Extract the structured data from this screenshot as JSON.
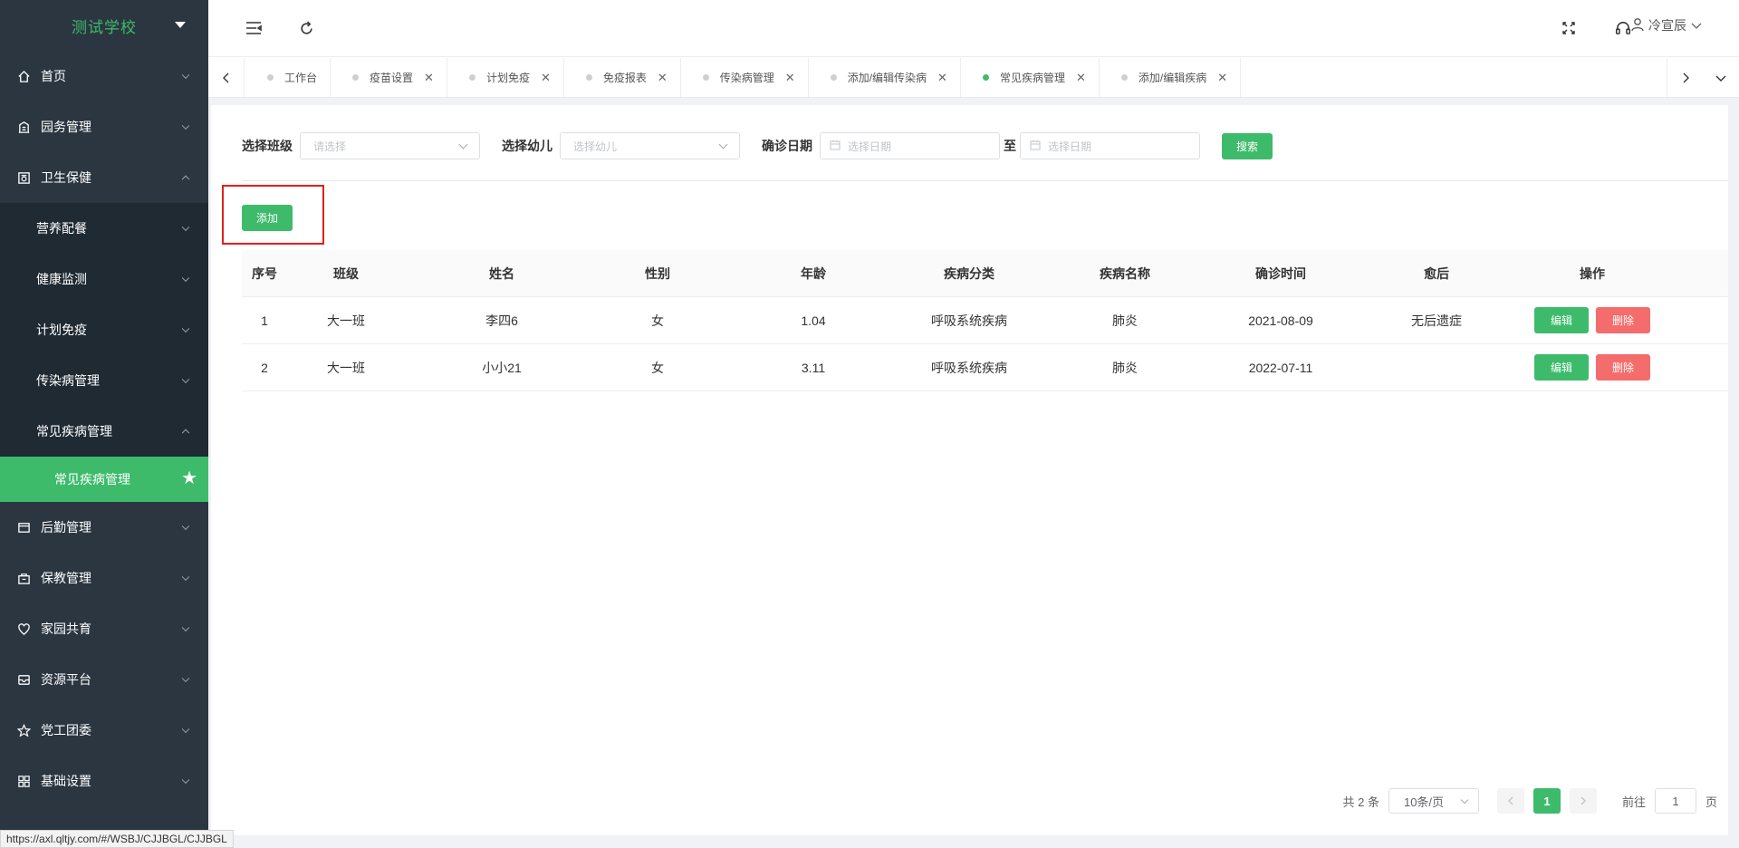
{
  "sidebar": {
    "school_name": "测试学校",
    "menu": [
      {
        "label": "首页",
        "icon": "home-icon"
      },
      {
        "label": "园务管理",
        "icon": "building-icon"
      },
      {
        "label": "卫生保健",
        "icon": "health-icon"
      }
    ],
    "health_sub": [
      {
        "label": "营养配餐"
      },
      {
        "label": "健康监测"
      },
      {
        "label": "计划免疫"
      },
      {
        "label": "传染病管理"
      },
      {
        "label": "常见疾病管理"
      }
    ],
    "active_item": "常见疾病管理",
    "menu_bottom": [
      {
        "label": "后勤管理",
        "icon": "logistics-icon"
      },
      {
        "label": "保教管理",
        "icon": "teaching-icon"
      },
      {
        "label": "家园共育",
        "icon": "home-school-icon"
      },
      {
        "label": "资源平台",
        "icon": "resource-icon"
      },
      {
        "label": "党工团委",
        "icon": "star-outline-icon"
      },
      {
        "label": "基础设置",
        "icon": "grid-icon"
      }
    ]
  },
  "header": {
    "user_name": "冷宣辰"
  },
  "tabs": [
    {
      "label": "工作台",
      "active": false,
      "closable": false
    },
    {
      "label": "疫苗设置",
      "active": false,
      "closable": true
    },
    {
      "label": "计划免疫",
      "active": false,
      "closable": true
    },
    {
      "label": "免疫报表",
      "active": false,
      "closable": true
    },
    {
      "label": "传染病管理",
      "active": false,
      "closable": true
    },
    {
      "label": "添加/编辑传染病",
      "active": false,
      "closable": true
    },
    {
      "label": "常见疾病管理",
      "active": true,
      "closable": true
    },
    {
      "label": "添加/编辑疾病",
      "active": false,
      "closable": true
    }
  ],
  "filter": {
    "class_label": "选择班级",
    "class_placeholder": "请选择",
    "child_label": "选择幼儿",
    "child_placeholder": "选择幼儿",
    "date_label": "确诊日期",
    "date_start_placeholder": "选择日期",
    "date_sep": "至",
    "date_end_placeholder": "选择日期",
    "search_label": "搜索"
  },
  "add_label": "添加",
  "table": {
    "headers": [
      "序号",
      "班级",
      "姓名",
      "性别",
      "年龄",
      "疾病分类",
      "疾病名称",
      "确诊时间",
      "愈后",
      "操作"
    ],
    "rows": [
      [
        "1",
        "大一班",
        "李四6",
        "女",
        "1.04",
        "呼吸系统疾病",
        "肺炎",
        "2021-08-09",
        "无后遗症"
      ],
      [
        "2",
        "大一班",
        "小小21",
        "女",
        "3.11",
        "呼吸系统疾病",
        "肺炎",
        "2022-07-11",
        ""
      ]
    ],
    "edit_label": "编辑",
    "delete_label": "删除"
  },
  "pagination": {
    "total_text": "共 2 条",
    "page_size": "10条/页",
    "current_page": "1",
    "goto_label": "前往",
    "goto_value": "1",
    "page_suffix": "页"
  },
  "status_url": "https://axl.qltjy.com/#/WSBJ/CJJBGL/CJJBGL",
  "colors": {
    "sidebar_bg": "#2b3641",
    "accent": "#3dbb6a",
    "danger": "#f56c6c",
    "highlight_border": "#e0201c"
  }
}
